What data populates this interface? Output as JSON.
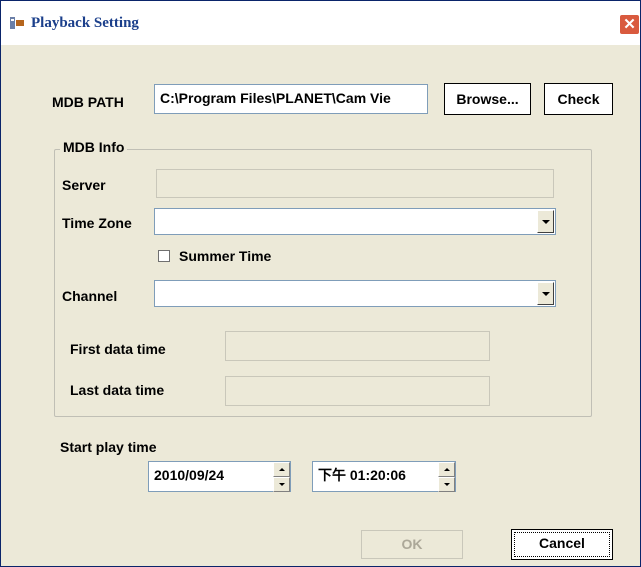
{
  "window": {
    "title": "Playback Setting",
    "close_glyph": "✕"
  },
  "mdb": {
    "path_label": "MDB PATH",
    "path_value": "C:\\Program Files\\PLANET\\Cam Vie",
    "browse_label": "Browse...",
    "check_label": "Check"
  },
  "info": {
    "group_label": "MDB Info",
    "server_label": "Server",
    "server_value": "",
    "timezone_label": "Time Zone",
    "timezone_value": "",
    "summer_time_label": "Summer Time",
    "summer_time_checked": false,
    "channel_label": "Channel",
    "channel_value": "",
    "first_data_label": "First data time",
    "first_data_value": "",
    "last_data_label": "Last data time",
    "last_data_value": ""
  },
  "start": {
    "label": "Start play time",
    "date": "2010/09/24",
    "time": "下午 01:20:06"
  },
  "footer": {
    "ok_label": "OK",
    "cancel_label": "Cancel"
  },
  "colors": {
    "title_text": "#1b3f8b",
    "close_button": "#d95a3e",
    "dialog_bg": "#ece9d8"
  }
}
